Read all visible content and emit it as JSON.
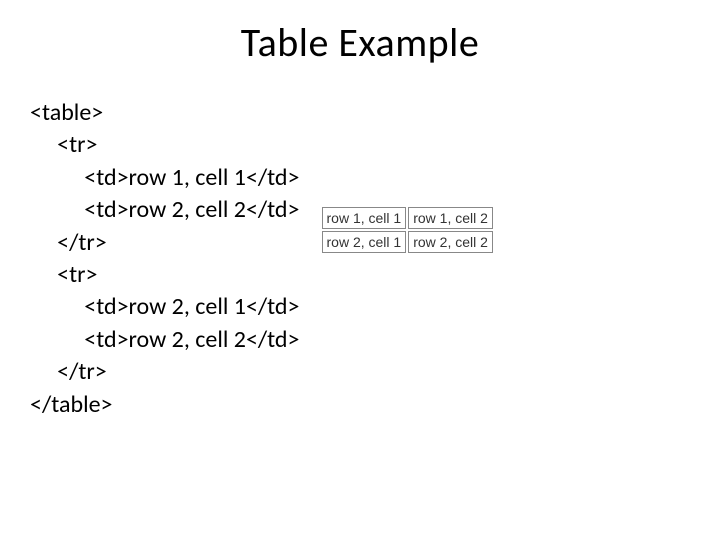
{
  "title": "Table Example",
  "code": {
    "l1": "<table>",
    "l2": "     <tr>",
    "l3": "          <td>row 1, cell 1</td>",
    "l4": "          <td>row 2, cell 2</td>",
    "l5": "     </tr>",
    "l6": "     <tr>",
    "l7": "          <td>row 2, cell 1</td>",
    "l8": "          <td>row 2, cell 2</td>",
    "l9": "     </tr>",
    "l10": "</table>"
  },
  "rendered": {
    "r1c1": "row 1, cell 1",
    "r1c2": "row 1, cell 2",
    "r2c1": "row 2, cell 1",
    "r2c2": "row 2, cell 2"
  }
}
